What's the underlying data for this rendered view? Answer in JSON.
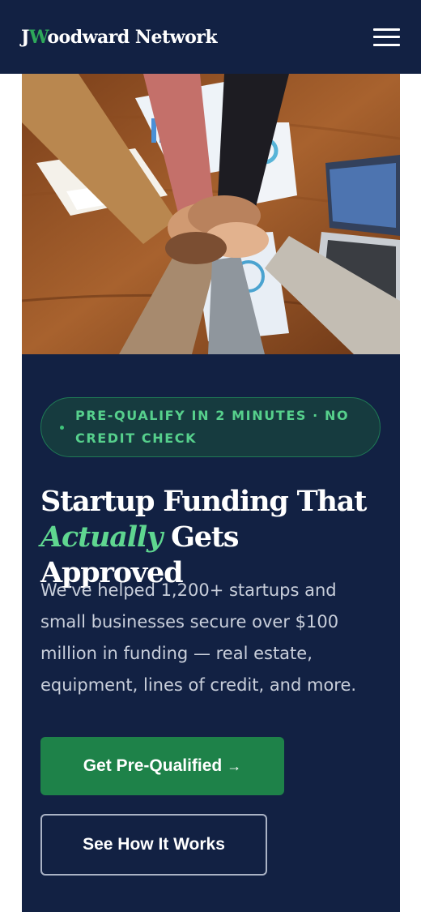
{
  "header": {
    "logo_first_letter": "J",
    "logo_accent_letter": "W",
    "logo_rest": "oodward Network",
    "menu_icon": "hamburger-menu-icon"
  },
  "hero_image": {
    "subject": "team stacking hands over a wooden table with papers, charts and a laptop"
  },
  "hero": {
    "badge": "PRE-QUALIFY IN 2 MINUTES · NO CREDIT CHECK",
    "headline_line1": "Startup Funding That",
    "headline_accent": "Actually",
    "headline_line2_rest": " Gets Approved",
    "body": "We've helped 1,200+ startups and small businesses secure over $100 million in funding — real estate, equipment, lines of credit, and more.",
    "primary_cta": "Get Pre-Qualified",
    "primary_cta_arrow": "→",
    "secondary_cta": "See How It Works"
  },
  "colors": {
    "navy": "#122143",
    "accent_green": "#1e8249",
    "light_green": "#5fd690"
  }
}
